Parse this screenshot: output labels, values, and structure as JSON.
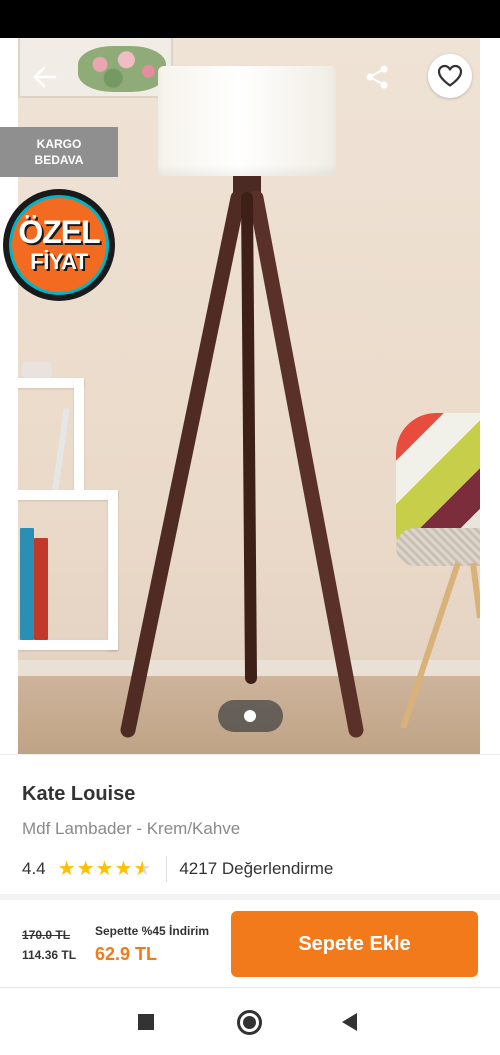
{
  "product": {
    "brand": "Kate Louise",
    "name": "Mdf Lambader - Krem/Kahve",
    "rating": "4.4",
    "rating_fraction": 0.88,
    "review_count": "4217 Değerlendirme"
  },
  "badges": {
    "cargo_line1": "KARGO",
    "cargo_line2": "BEDAVA",
    "special_line1": "ÖZEL",
    "special_line2": "FİYAT"
  },
  "gallery": {
    "current_index": 1,
    "total": 1
  },
  "pricing": {
    "old_price": "170.0 TL",
    "current_price": "114.36 TL",
    "basket_discount": "Sepette %45 İndirim",
    "basket_price": "62.9 TL"
  },
  "actions": {
    "add_to_cart": "Sepete Ekle"
  },
  "icons": {
    "back": "arrow-left-icon",
    "share": "share-icon",
    "favorite": "heart-outline-icon",
    "nav_recents": "square-icon",
    "nav_home": "circle-icon",
    "nav_back": "triangle-back-icon"
  },
  "colors": {
    "accent": "#f27a1a",
    "star": "#ffc000",
    "cargo_badge": "#8f8f8f",
    "special_badge": "#f36b21"
  }
}
